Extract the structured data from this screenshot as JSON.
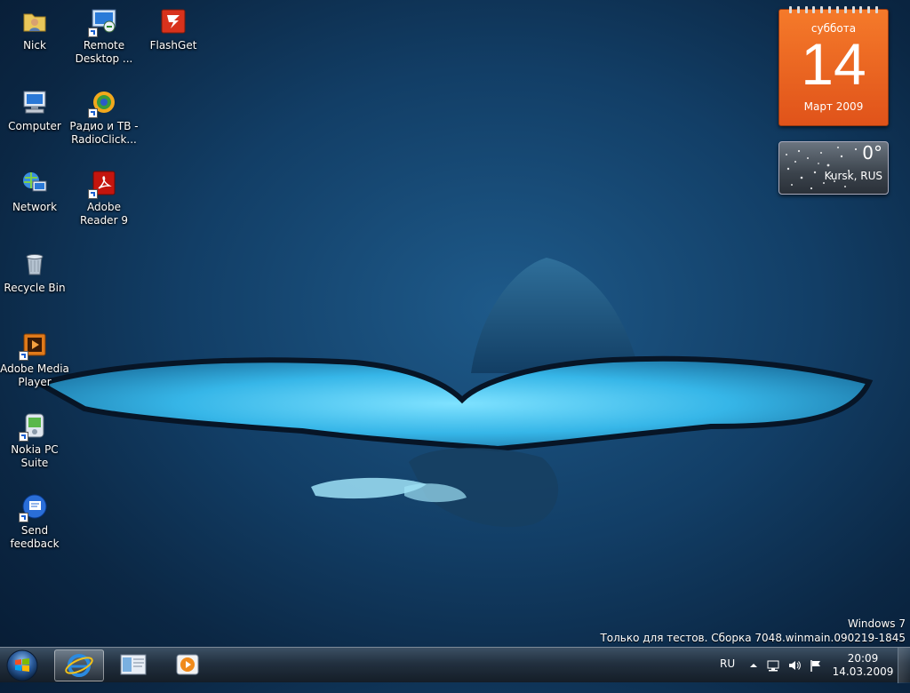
{
  "desktop": {
    "icons": [
      {
        "label": "Nick",
        "icon": "user-folder-icon"
      },
      {
        "label": "Remote Desktop ...",
        "icon": "remote-desktop-icon"
      },
      {
        "label": "FlashGet",
        "icon": "flashget-icon"
      },
      {
        "label": "Computer",
        "icon": "computer-icon"
      },
      {
        "label": "Радио и ТВ - RadioClick...",
        "icon": "radioclick-icon"
      },
      {
        "label": "Network",
        "icon": "network-icon"
      },
      {
        "label": "Adobe Reader 9",
        "icon": "adobe-reader-icon"
      },
      {
        "label": "Recycle Bin",
        "icon": "recycle-bin-icon"
      },
      {
        "label": "Adobe Media Player",
        "icon": "adobe-media-player-icon"
      },
      {
        "label": "Nokia PC Suite",
        "icon": "nokia-pc-suite-icon"
      },
      {
        "label": "Send feedback",
        "icon": "send-feedback-icon"
      }
    ]
  },
  "gadgets": {
    "calendar": {
      "day_of_week": "суббота",
      "day": "14",
      "month_year": "Март 2009",
      "color": "#e8631f"
    },
    "weather": {
      "temperature": "0°",
      "location": "Kursk, RUS"
    }
  },
  "watermark": {
    "line1": "Windows 7",
    "line2": "Только для тестов. Сборка 7048.winmain.090219-1845"
  },
  "taskbar": {
    "start_icon": "windows-orb-icon",
    "pinned": [
      {
        "icon": "internet-explorer-icon",
        "active": true
      },
      {
        "icon": "windows-explorer-icon",
        "active": false
      },
      {
        "icon": "media-player-icon",
        "active": false
      }
    ],
    "tray": {
      "language": "RU",
      "icons": [
        "show-hidden-icons-icon",
        "network-icon",
        "volume-icon",
        "action-center-flag-icon"
      ],
      "time": "20:09",
      "date": "14.03.2009"
    }
  }
}
